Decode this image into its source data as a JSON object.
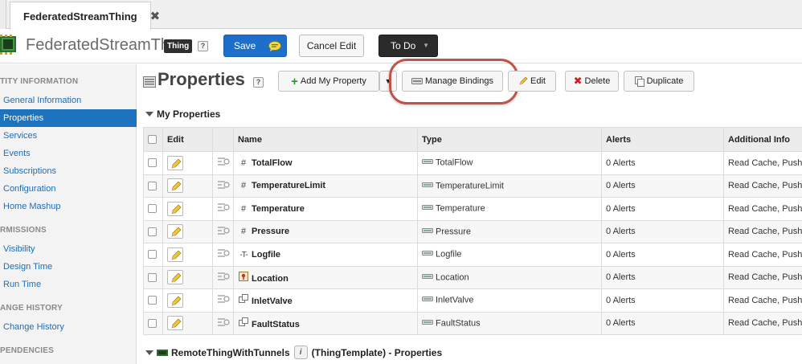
{
  "tab": {
    "title": "FederatedStreamThing",
    "close": "✖"
  },
  "header": {
    "title": "FederatedStreamTh...",
    "badge": "Thing",
    "help": "?",
    "save_label": "Save",
    "cancel_label": "Cancel Edit",
    "todo_label": "To Do"
  },
  "sidebar": {
    "sections": [
      {
        "heading": "TITY INFORMATION",
        "items": [
          "General Information",
          "Properties",
          "Services",
          "Events",
          "Subscriptions",
          "Configuration",
          "Home Mashup"
        ]
      },
      {
        "heading": "RMISSIONS",
        "items": [
          "Visibility",
          "Design Time",
          "Run Time"
        ]
      },
      {
        "heading": "ANGE HISTORY",
        "items": [
          "Change History"
        ]
      },
      {
        "heading": "PENDENCIES",
        "items": []
      }
    ],
    "active_item": "Properties"
  },
  "main": {
    "title": "Properties",
    "help": "?",
    "toolbar": {
      "add_label": "Add My Property",
      "manage_label": "Manage Bindings",
      "edit_label": "Edit",
      "delete_label": "Delete",
      "duplicate_label": "Duplicate"
    },
    "my_properties_heading": "My Properties",
    "columns": [
      "Edit",
      "Name",
      "Type",
      "Alerts",
      "Additional Info"
    ],
    "rows": [
      {
        "name": "TotalFlow",
        "base_type_icon": "#",
        "type": "TotalFlow",
        "alerts": "0 Alerts",
        "info": "Read Cache, Push:"
      },
      {
        "name": "TemperatureLimit",
        "base_type_icon": "#",
        "type": "TemperatureLimit",
        "alerts": "0 Alerts",
        "info": "Read Cache, Push:"
      },
      {
        "name": "Temperature",
        "base_type_icon": "#",
        "type": "Temperature",
        "alerts": "0 Alerts",
        "info": "Read Cache, Push:"
      },
      {
        "name": "Pressure",
        "base_type_icon": "#",
        "type": "Pressure",
        "alerts": "0 Alerts",
        "info": "Read Cache, Push:"
      },
      {
        "name": "Logfile",
        "base_type_icon": "-T-",
        "type": "Logfile",
        "alerts": "0 Alerts",
        "info": "Read Cache, Push:"
      },
      {
        "name": "Location",
        "base_type_icon": "location",
        "type": "Location",
        "alerts": "0 Alerts",
        "info": "Read Cache, Push:"
      },
      {
        "name": "InletValve",
        "base_type_icon": "boolean",
        "type": "InletValve",
        "alerts": "0 Alerts",
        "info": "Read Cache, Push:"
      },
      {
        "name": "FaultStatus",
        "base_type_icon": "boolean",
        "type": "FaultStatus",
        "alerts": "0 Alerts",
        "info": "Read Cache, Push:"
      }
    ],
    "inherited": {
      "template_name": "RemoteThingWithTunnels",
      "info_icon": "i",
      "suffix": "(ThingTemplate) - Properties"
    }
  },
  "colors": {
    "accent": "#1e73be",
    "save": "#1e6fc9",
    "highlight": "#c0524a"
  }
}
